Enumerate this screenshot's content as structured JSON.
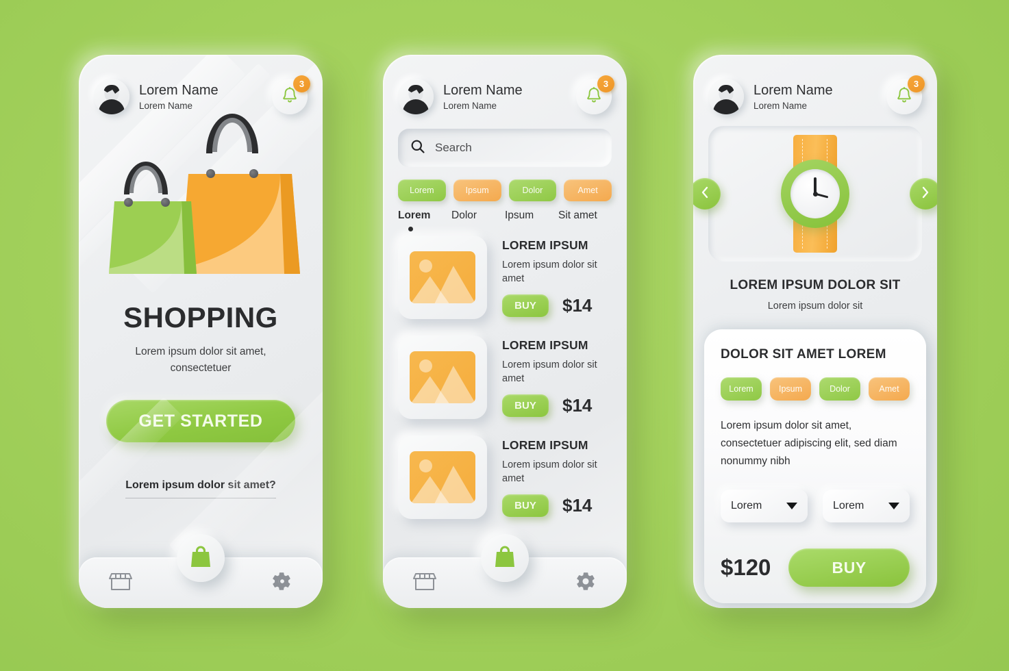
{
  "canvas": {
    "background_color": "#a3d15c"
  },
  "accents": {
    "green": "#8cc63f",
    "orange": "#f4a94e",
    "dark": "#2b2c2e"
  },
  "header": {
    "name_primary": "Lorem Name",
    "name_secondary": "Lorem Name",
    "avatar_icon": "user-avatar-icon",
    "bell_icon": "bell-icon",
    "badge_count": "3"
  },
  "bottom_nav": {
    "store_icon": "store-icon",
    "bag_icon": "shopping-bag-icon",
    "settings_icon": "gear-icon"
  },
  "screen1": {
    "illustration_icon": "shopping-bags-illustration",
    "title": "SHOPPING",
    "subtitle": "Lorem ipsum dolor sit amet, consectetuer",
    "cta_label": "GET STARTED",
    "link_label": "Lorem ipsum dolor sit amet?"
  },
  "screen2": {
    "search": {
      "placeholder": "Search",
      "icon": "search-icon"
    },
    "chips": [
      {
        "label": "Lorem",
        "color": "green"
      },
      {
        "label": "Ipsum",
        "color": "orange"
      },
      {
        "label": "Dolor",
        "color": "green"
      },
      {
        "label": "Amet",
        "color": "orange"
      }
    ],
    "tabs": [
      {
        "label": "Lorem",
        "active": true
      },
      {
        "label": "Dolor",
        "active": false
      },
      {
        "label": "Ipsum",
        "active": false
      },
      {
        "label": "Sit amet",
        "active": false
      }
    ],
    "products": [
      {
        "title": "LOREM IPSUM",
        "desc": "Lorem ipsum dolor sit amet",
        "buy_label": "BUY",
        "price": "$14",
        "thumb_icon": "image-placeholder-icon"
      },
      {
        "title": "LOREM IPSUM",
        "desc": "Lorem ipsum dolor sit amet",
        "buy_label": "BUY",
        "price": "$14",
        "thumb_icon": "image-placeholder-icon"
      },
      {
        "title": "LOREM IPSUM",
        "desc": "Lorem ipsum dolor sit amet",
        "buy_label": "BUY",
        "price": "$14",
        "thumb_icon": "image-placeholder-icon"
      }
    ]
  },
  "screen3": {
    "product_image_icon": "wristwatch-icon",
    "prev_icon": "chevron-left-icon",
    "next_icon": "chevron-right-icon",
    "title": "LOREM IPSUM DOLOR SIT",
    "subtitle": "Lorem ipsum dolor sit",
    "detail_title": "DOLOR SIT AMET LOREM",
    "chips": [
      {
        "label": "Lorem",
        "color": "green"
      },
      {
        "label": "Ipsum",
        "color": "orange"
      },
      {
        "label": "Dolor",
        "color": "green"
      },
      {
        "label": "Amet",
        "color": "orange"
      }
    ],
    "description": "Lorem ipsum dolor sit amet, consectetuer adipiscing elit, sed diam nonummy nibh",
    "selects": [
      {
        "value": "Lorem",
        "caret_icon": "caret-down-icon"
      },
      {
        "value": "Lorem",
        "caret_icon": "caret-down-icon"
      }
    ],
    "price": "$120",
    "buy_label": "BUY"
  }
}
